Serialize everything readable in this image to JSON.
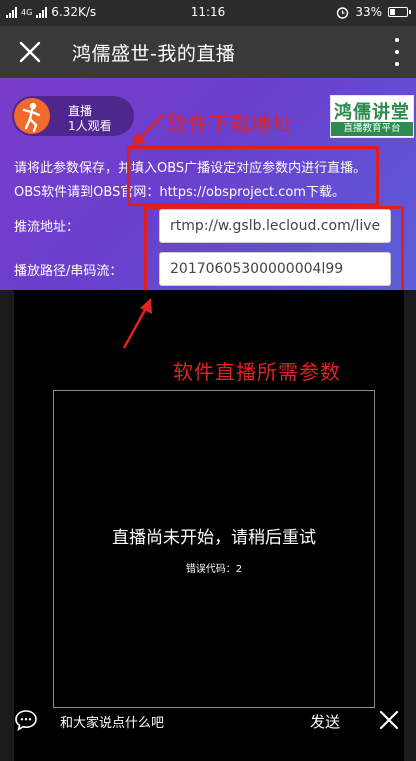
{
  "status_bar": {
    "network": "4G",
    "speed": "6.32K/s",
    "time": "11:16",
    "battery": "33%",
    "battery_level": 0.33
  },
  "title_bar": {
    "title": "鸿儒盛世-我的直播"
  },
  "live_badge": {
    "label": "直播",
    "viewers": "1人观看"
  },
  "logo": {
    "main": "鸿儒讲堂",
    "sub": "直播教育平台"
  },
  "annotations": {
    "download": "软件下载地址",
    "params": "软件直播所需参数"
  },
  "info": {
    "line1": "请将此参数保存，并填入OBS广播设定对应参数内进行直播。",
    "line2": "OBS软件请到OBS官网：https://obsproject.com下载。"
  },
  "fields": {
    "push_label": "推流地址：",
    "push_value": "rtmp://w.gslb.lecloud.com/live",
    "stream_label": "播放路径/串码流：",
    "stream_value": "20170605300000004l99"
  },
  "player": {
    "message": "直播尚未开始，请稍后重试",
    "error": "错误代码：2"
  },
  "bottom": {
    "placeholder": "和大家说点什么吧",
    "send": "发送"
  },
  "colors": {
    "purple": "#6a3fce",
    "annotation_red": "#e02222",
    "logo_green": "#2e8b4d"
  }
}
